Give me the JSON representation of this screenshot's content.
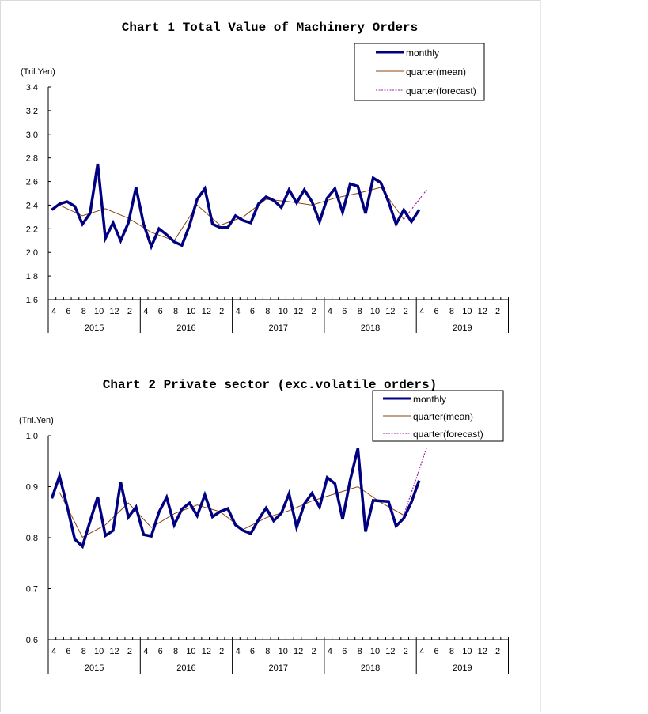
{
  "chart_data": [
    {
      "type": "line",
      "title": "Chart 1 Total Value of Machinery Orders",
      "ylabel": "(Tril.Yen)",
      "xlabel": "",
      "ylim": [
        1.6,
        3.4
      ],
      "yticks": [
        "3.4",
        "3.2",
        "3.0",
        "2.8",
        "2.6",
        "2.4",
        "2.2",
        "2.0",
        "1.8",
        "1.6"
      ],
      "ytick_values": [
        3.4,
        3.2,
        3.0,
        2.8,
        2.6,
        2.4,
        2.2,
        2.0,
        1.8,
        1.6
      ],
      "month_labels": [
        "4",
        "6",
        "8",
        "10",
        "12",
        "2"
      ],
      "years": [
        "2015",
        "2016",
        "2017",
        "2018",
        "2019"
      ],
      "legend": {
        "position": "top-right",
        "entries": [
          "monthly",
          "quarter(mean)",
          "quarter(forecast)"
        ]
      },
      "colors": {
        "monthly": "#000080",
        "quarter_mean": "#8B4513",
        "quarter_forecast": "#A020A0"
      },
      "series": [
        {
          "name": "monthly",
          "x_month_index": [
            0,
            1,
            2,
            3,
            4,
            5,
            6,
            7,
            8,
            9,
            10,
            11,
            12,
            13,
            14,
            15,
            16,
            17,
            18,
            19,
            20,
            21,
            22,
            23,
            24,
            25,
            26,
            27,
            28,
            29,
            30,
            31,
            32,
            33,
            34,
            35,
            36,
            37,
            38,
            39,
            40,
            41,
            42,
            43,
            44,
            45,
            46,
            47,
            48,
            49
          ],
          "values": [
            2.36,
            2.41,
            2.43,
            2.39,
            2.24,
            2.33,
            2.75,
            2.12,
            2.25,
            2.1,
            2.25,
            2.55,
            2.24,
            2.05,
            2.2,
            2.15,
            2.09,
            2.06,
            2.23,
            2.45,
            2.54,
            2.24,
            2.21,
            2.21,
            2.31,
            2.27,
            2.25,
            2.41,
            2.47,
            2.44,
            2.38,
            2.53,
            2.42,
            2.53,
            2.43,
            2.26,
            2.46,
            2.54,
            2.34,
            2.58,
            2.56,
            2.33,
            2.63,
            2.59,
            2.43,
            2.24,
            2.36,
            2.26,
            2.36
          ]
        },
        {
          "name": "quarter(mean)",
          "x_month_index": [
            1,
            4,
            7,
            10,
            13,
            16,
            19,
            22,
            25,
            28,
            31,
            34,
            37,
            40,
            43,
            46
          ],
          "values": [
            2.4,
            2.31,
            2.37,
            2.29,
            2.17,
            2.1,
            2.4,
            2.23,
            2.3,
            2.45,
            2.43,
            2.4,
            2.46,
            2.5,
            2.55,
            2.28
          ]
        },
        {
          "name": "quarter(forecast)",
          "x_month_index": [
            46,
            49
          ],
          "values": [
            2.28,
            2.53
          ]
        }
      ]
    },
    {
      "type": "line",
      "title": "Chart 2 Private sector (exc.volatile orders)",
      "ylabel": "(Tril.Yen)",
      "xlabel": "",
      "ylim": [
        0.6,
        1.0
      ],
      "yticks": [
        "1.0",
        "0.9",
        "0.8",
        "0.7",
        "0.6"
      ],
      "ytick_values": [
        1.0,
        0.9,
        0.8,
        0.7,
        0.6
      ],
      "month_labels": [
        "4",
        "6",
        "8",
        "10",
        "12",
        "2"
      ],
      "years": [
        "2015",
        "2016",
        "2017",
        "2018",
        "2019"
      ],
      "legend": {
        "position": "top-right",
        "entries": [
          "monthly",
          "quarter(mean)",
          "quarter(forecast)"
        ]
      },
      "colors": {
        "monthly": "#000080",
        "quarter_mean": "#8B4513",
        "quarter_forecast": "#A020A0"
      },
      "series": [
        {
          "name": "monthly",
          "x_month_index": [
            0,
            1,
            2,
            3,
            4,
            5,
            6,
            7,
            8,
            9,
            10,
            11,
            12,
            13,
            14,
            15,
            16,
            17,
            18,
            19,
            20,
            21,
            22,
            23,
            24,
            25,
            26,
            27,
            28,
            29,
            30,
            31,
            32,
            33,
            34,
            35,
            36,
            37,
            38,
            39,
            40,
            41,
            42,
            43,
            44,
            45,
            46,
            47,
            48,
            49
          ],
          "values": [
            0.877,
            0.921,
            0.862,
            0.797,
            0.783,
            0.832,
            0.88,
            0.804,
            0.814,
            0.909,
            0.84,
            0.86,
            0.806,
            0.803,
            0.85,
            0.879,
            0.825,
            0.856,
            0.868,
            0.843,
            0.884,
            0.841,
            0.851,
            0.857,
            0.825,
            0.814,
            0.808,
            0.835,
            0.858,
            0.833,
            0.848,
            0.886,
            0.82,
            0.866,
            0.887,
            0.86,
            0.918,
            0.906,
            0.836,
            0.913,
            0.975,
            0.812,
            0.873,
            0.872,
            0.871,
            0.823,
            0.838,
            0.87,
            0.912
          ]
        },
        {
          "name": "quarter(mean)",
          "x_month_index": [
            1,
            4,
            7,
            10,
            13,
            16,
            19,
            22,
            25,
            28,
            31,
            34,
            37,
            40,
            43,
            46
          ],
          "values": [
            0.889,
            0.801,
            0.825,
            0.868,
            0.82,
            0.847,
            0.864,
            0.851,
            0.816,
            0.839,
            0.853,
            0.872,
            0.886,
            0.9,
            0.869,
            0.844
          ]
        },
        {
          "name": "quarter(forecast)",
          "x_month_index": [
            46,
            49
          ],
          "values": [
            0.844,
            0.977
          ]
        }
      ]
    }
  ]
}
